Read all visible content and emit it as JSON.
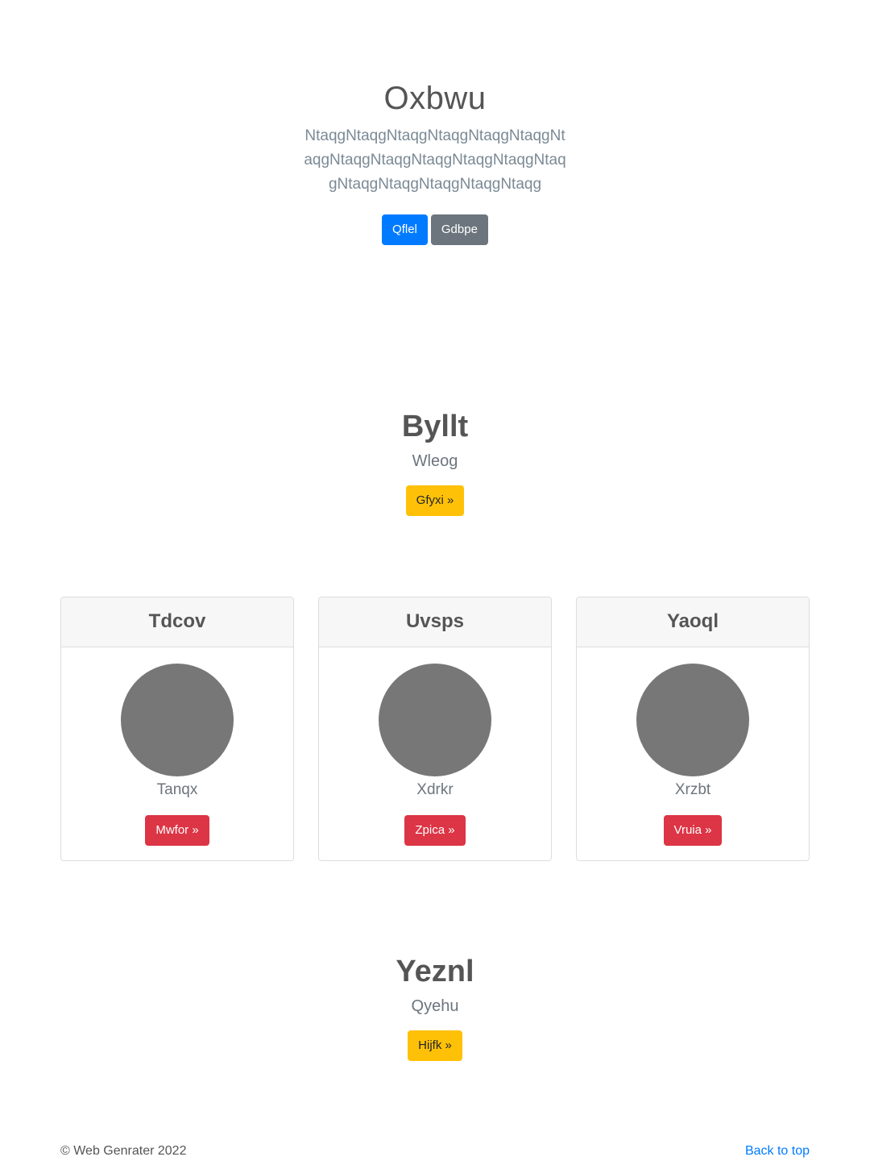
{
  "hero": {
    "title": "Oxbwu",
    "lead": "NtaqgNtaqgNtaqgNtaqgNtaqgNtaqgNtaqgNtaqgNtaqgNtaqgNtaqgNtaqgNtaqgNtaqgNtaqgNtaqgNtaqgNtaqg",
    "primary_button": "Qflel",
    "secondary_button": "Gdbpe"
  },
  "feature1": {
    "title": "Byllt",
    "subtitle": "Wleog",
    "button": "Gfyxi »"
  },
  "cards": [
    {
      "header": "Tdcov",
      "text": "Tanqx",
      "button": "Mwfor »"
    },
    {
      "header": "Uvsps",
      "text": "Xdrkr",
      "button": "Zpica »"
    },
    {
      "header": "Yaoql",
      "text": "Xrzbt",
      "button": "Vruia »"
    }
  ],
  "feature2": {
    "title": "Yeznl",
    "subtitle": "Qyehu",
    "button": "Hijfk »"
  },
  "footer": {
    "copyright": "© Web Genrater 2022",
    "back_to_top": "Back to top"
  },
  "colors": {
    "primary": "#007bff",
    "secondary": "#6c757d",
    "warning": "#ffc107",
    "danger": "#dc3545",
    "avatar": "#777777"
  }
}
